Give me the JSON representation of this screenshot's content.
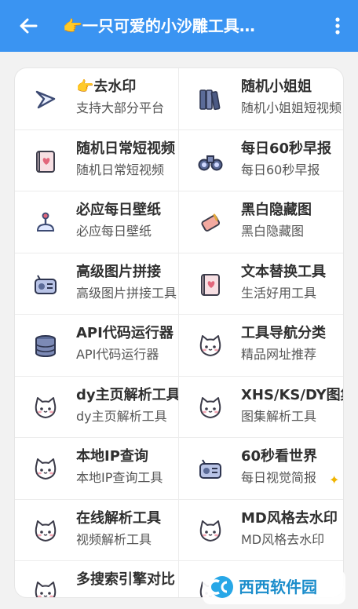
{
  "appbar": {
    "title": "👉一只可爱的小沙雕工具…"
  },
  "rows": [
    {
      "left": {
        "name": "👉去水印",
        "desc": "支持大部分平台",
        "icon": "play-arrow-icon"
      },
      "right": {
        "name": "随机小姐姐",
        "desc": "随机小姐姐短视频",
        "icon": "books-icon"
      }
    },
    {
      "left": {
        "name": "随机日常短视频",
        "desc": "随机日常短视频",
        "icon": "heart-book-icon"
      },
      "right": {
        "name": "每日60秒早报",
        "desc": "每日60秒早报",
        "icon": "binoculars-icon"
      }
    },
    {
      "left": {
        "name": "必应每日壁纸",
        "desc": "必应每日壁纸",
        "icon": "joystick-icon"
      },
      "right": {
        "name": "黑白隐藏图",
        "desc": "黑白隐藏图",
        "icon": "eraser-icon"
      }
    },
    {
      "left": {
        "name": "高级图片拼接",
        "desc": "高级图片拼接工具",
        "icon": "radio-icon"
      },
      "right": {
        "name": "文本替换工具",
        "desc": "生活好用工具",
        "icon": "heart-book-icon"
      }
    },
    {
      "left": {
        "name": "API代码运行器",
        "desc": "API代码运行器",
        "icon": "database-icon"
      },
      "right": {
        "name": "工具导航分类",
        "desc": "精品网址推荐",
        "icon": "cat-icon"
      }
    },
    {
      "left": {
        "name": "dy主页解析工具",
        "desc": "dy主页解析工具",
        "icon": "cat-icon"
      },
      "right": {
        "name": "XHS/KS/DY图集",
        "desc": "图集解析工具",
        "icon": "cat-icon"
      }
    },
    {
      "left": {
        "name": "本地IP查询",
        "desc": "本地IP查询工具",
        "icon": "cat-icon"
      },
      "right": {
        "name": "60秒看世界",
        "desc": "每日视觉简报",
        "icon": "radio-icon"
      }
    },
    {
      "left": {
        "name": "在线解析工具",
        "desc": "视频解析工具",
        "icon": "cat-icon"
      },
      "right": {
        "name": "MD风格去水印",
        "desc": "MD风格去水印",
        "icon": "cat-icon"
      }
    },
    {
      "left": {
        "name": "多搜索引擎对比",
        "desc": "",
        "icon": "cat-icon"
      },
      "right": {
        "name": "",
        "desc": "",
        "icon": "cat-icon"
      }
    }
  ],
  "watermark": {
    "text": "西西软件园",
    "icon": "cc-logo-icon"
  }
}
